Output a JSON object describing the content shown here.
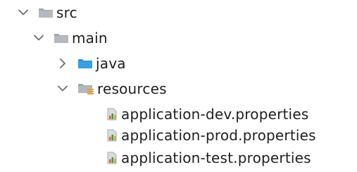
{
  "tree": {
    "src": {
      "label": "src",
      "icon": "folder-icon",
      "expanded": true
    },
    "main": {
      "label": "main",
      "icon": "folder-icon",
      "expanded": true
    },
    "java": {
      "label": "java",
      "icon": "source-folder-icon",
      "expanded": false
    },
    "resources": {
      "label": "resources",
      "icon": "resources-folder-icon",
      "expanded": true
    },
    "files": [
      {
        "label": "application-dev.properties",
        "icon": "properties-file-icon"
      },
      {
        "label": "application-prod.properties",
        "icon": "properties-file-icon"
      },
      {
        "label": "application-test.properties",
        "icon": "properties-file-icon"
      }
    ]
  },
  "colors": {
    "folder_grey": "#a0a6ad",
    "folder_blue": "#3a9ee0",
    "resource_accent": "#e6a23c",
    "chevron": "#6e6e6e",
    "text": "#1f1f1f"
  }
}
